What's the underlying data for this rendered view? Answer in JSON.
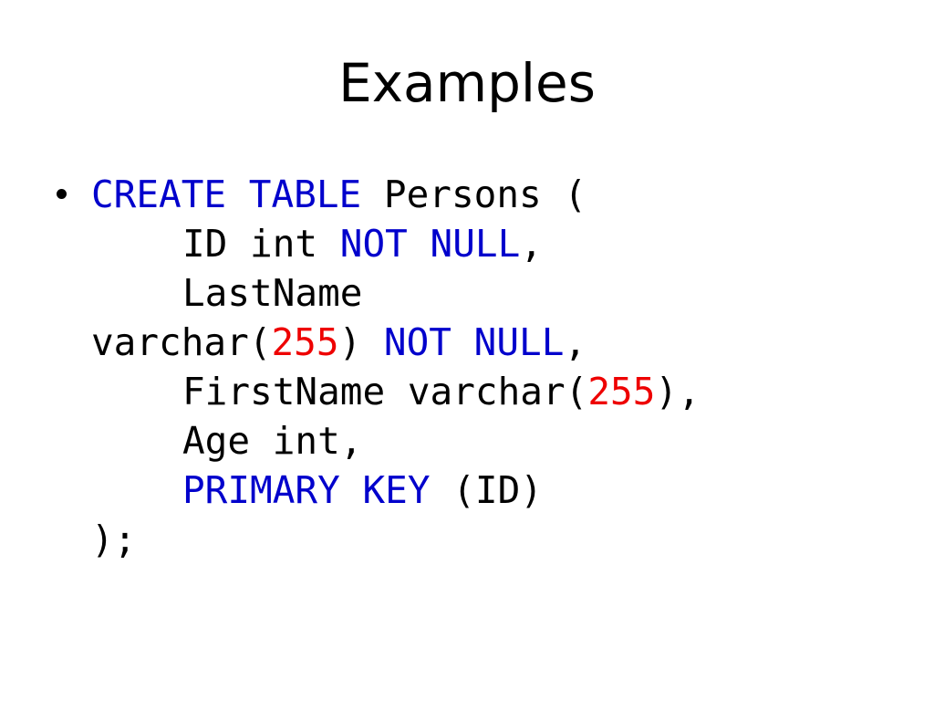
{
  "slide": {
    "title": "Examples",
    "background_color": "#FFFFFF",
    "palette": {
      "keyword_blue": "#0000CC",
      "number_red": "#EE0000",
      "text_black": "#000000"
    },
    "bullet": {
      "marker": "•",
      "shape": "round-dot",
      "color": "#000000"
    },
    "code": {
      "language": "SQL",
      "full_text": "CREATE TABLE Persons (\n      ID int NOT NULL,\n      LastName varchar(255) NOT NULL,\n      FirstName varchar(255),\n      Age int,\n      PRIMARY KEY (ID)\n);",
      "lines": [
        {
          "id": "line-1",
          "indent": 0,
          "bulleted": true,
          "tokens": [
            {
              "text": "CREATE TABLE",
              "kind": "keyword"
            },
            {
              "text": " Persons (",
              "kind": "plain"
            }
          ]
        },
        {
          "id": "line-2",
          "indent": 1,
          "bulleted": false,
          "tokens": [
            {
              "text": "ID int ",
              "kind": "plain"
            },
            {
              "text": "NOT NULL",
              "kind": "keyword"
            },
            {
              "text": ",",
              "kind": "plain"
            }
          ]
        },
        {
          "id": "line-3",
          "indent": 1,
          "bulleted": false,
          "tokens": [
            {
              "text": "LastName",
              "kind": "plain"
            }
          ]
        },
        {
          "id": "line-4",
          "indent": 0,
          "bulleted": false,
          "tokens": [
            {
              "text": "varchar(",
              "kind": "plain"
            },
            {
              "text": "255",
              "kind": "number"
            },
            {
              "text": ") ",
              "kind": "plain"
            },
            {
              "text": "NOT NULL",
              "kind": "keyword"
            },
            {
              "text": ",",
              "kind": "plain"
            }
          ]
        },
        {
          "id": "line-5",
          "indent": 1,
          "bulleted": false,
          "tokens": [
            {
              "text": "FirstName varchar(",
              "kind": "plain"
            },
            {
              "text": "255",
              "kind": "number"
            },
            {
              "text": "),",
              "kind": "plain"
            }
          ]
        },
        {
          "id": "line-6",
          "indent": 1,
          "bulleted": false,
          "tokens": [
            {
              "text": "Age int,",
              "kind": "plain"
            }
          ]
        },
        {
          "id": "line-7",
          "indent": 1,
          "bulleted": false,
          "tokens": [
            {
              "text": "PRIMARY KEY",
              "kind": "keyword"
            },
            {
              "text": " (ID)",
              "kind": "plain"
            }
          ]
        },
        {
          "id": "line-8",
          "indent": 0,
          "bulleted": false,
          "tokens": [
            {
              "text": ");",
              "kind": "plain"
            }
          ]
        }
      ]
    }
  }
}
